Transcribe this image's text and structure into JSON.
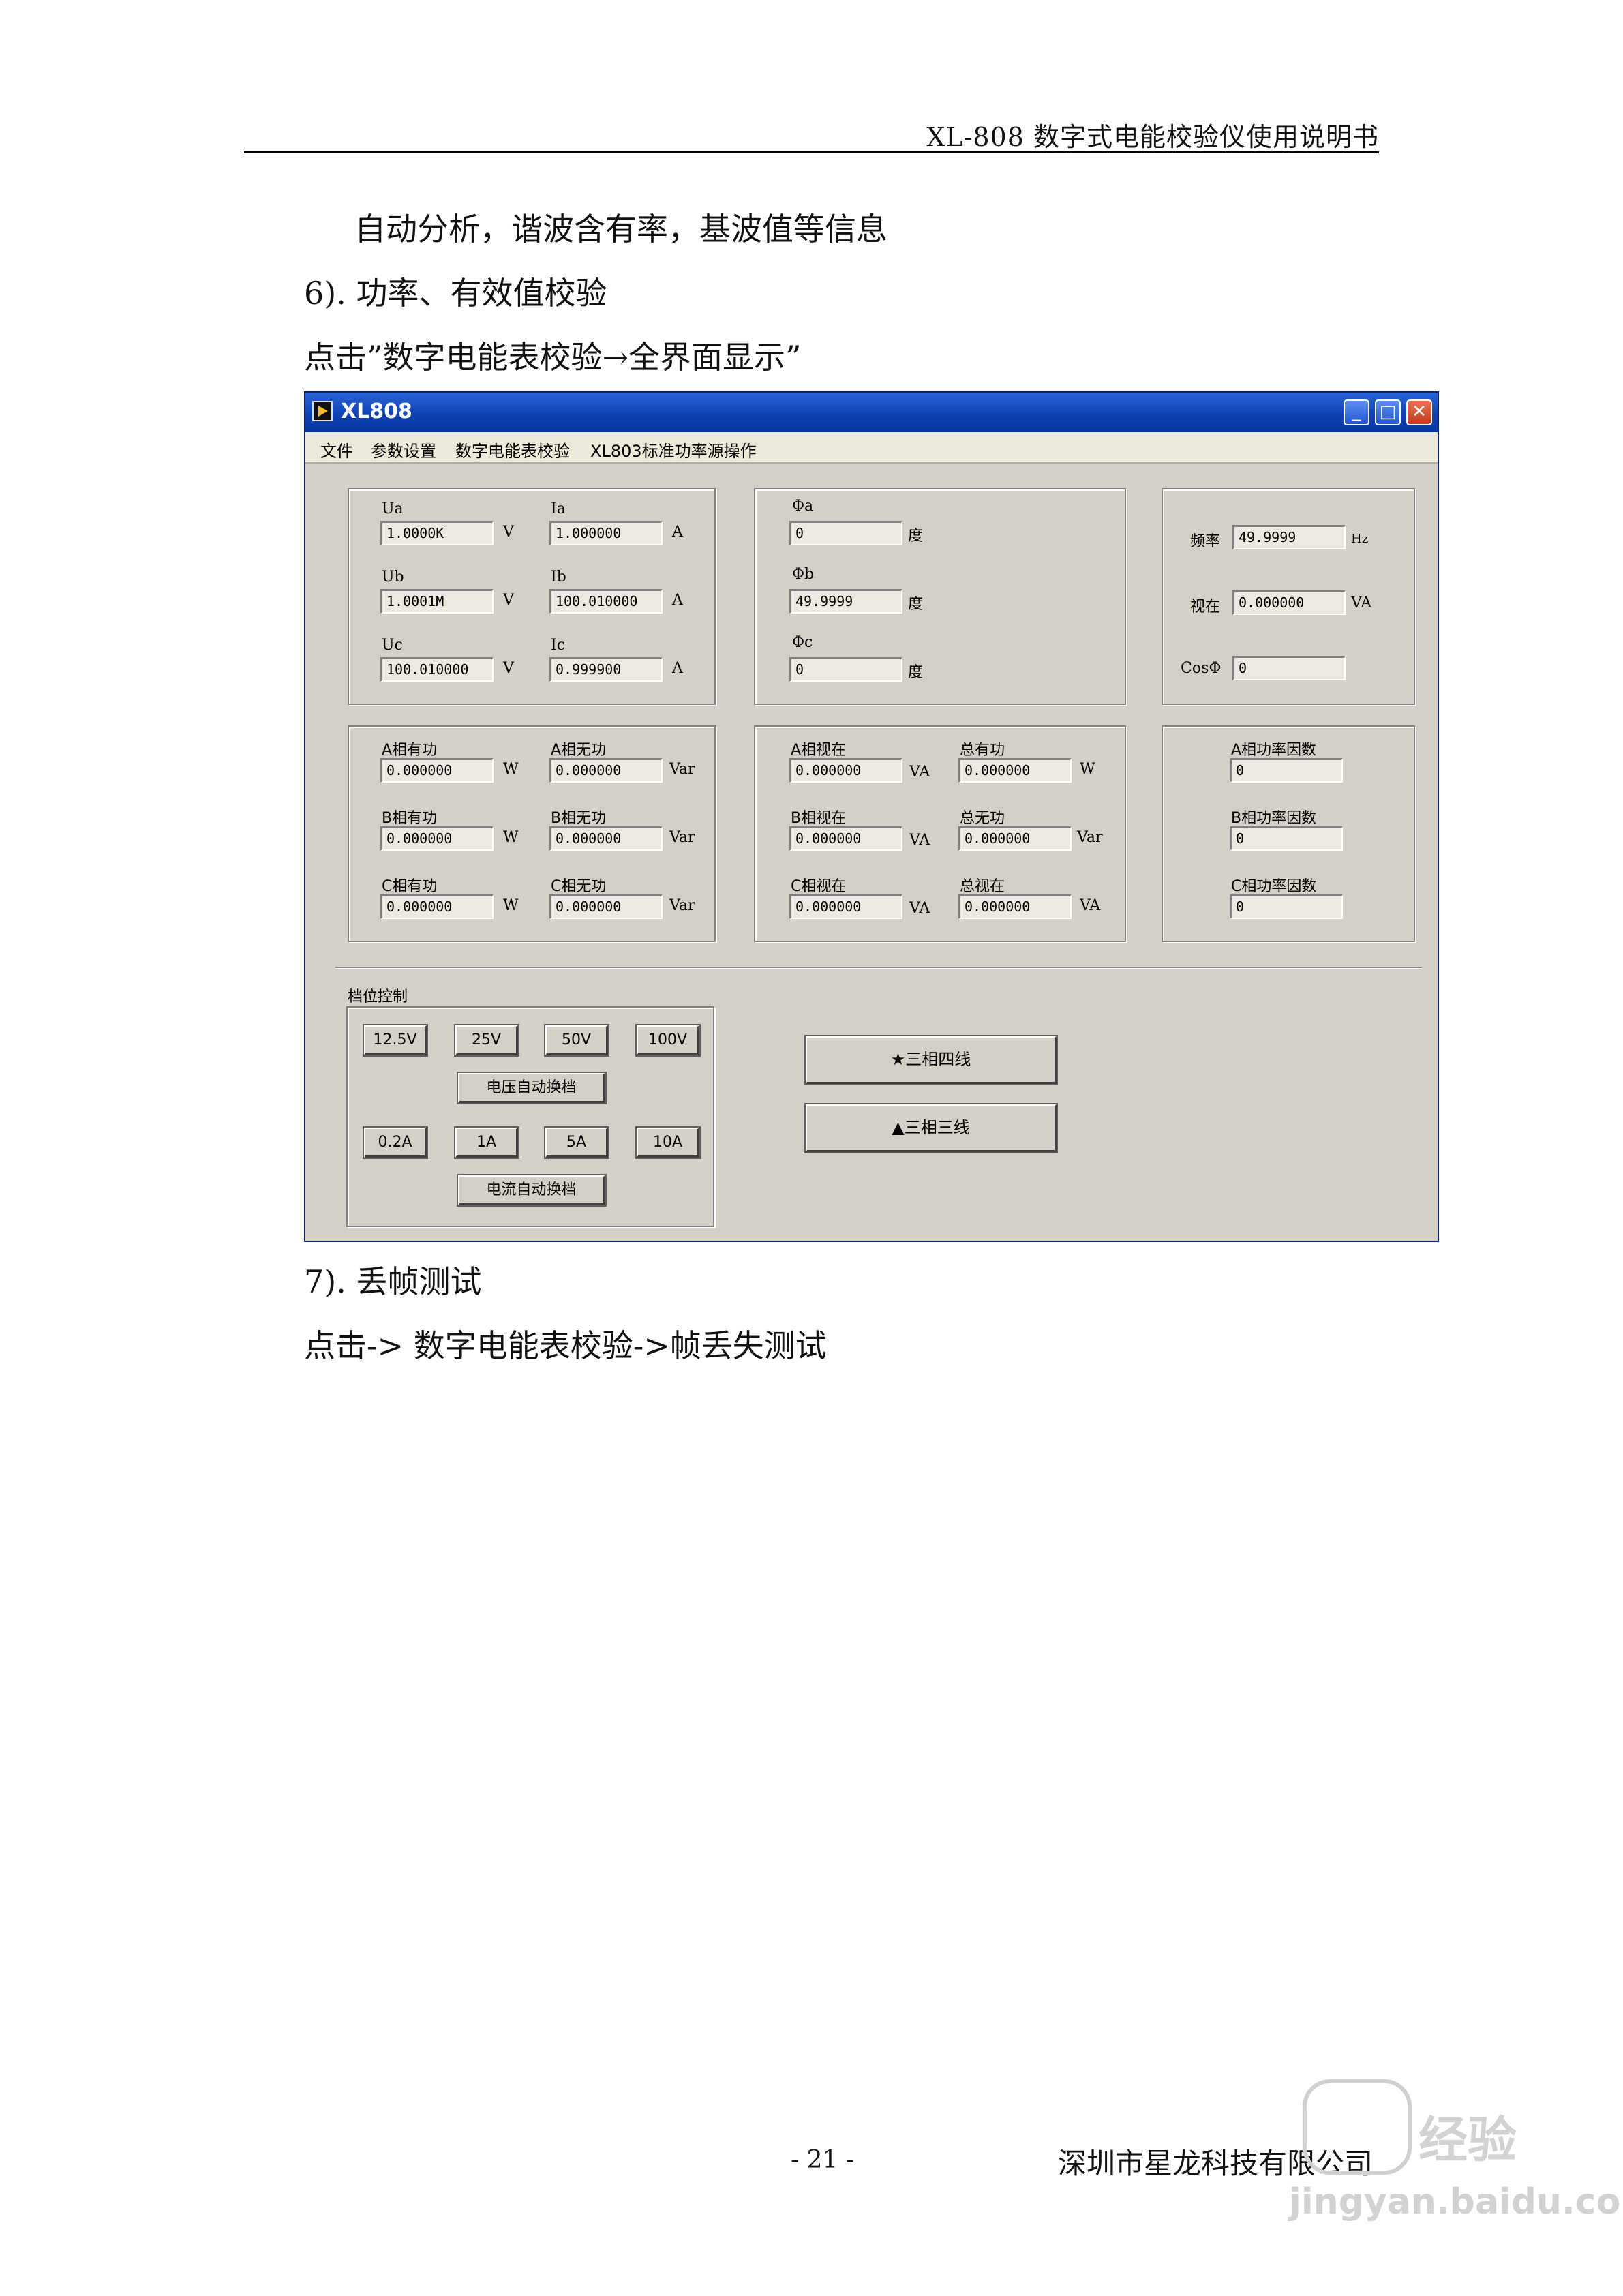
{
  "header": {
    "title": "XL-808 数字式电能校验仪使用说明书"
  },
  "body": {
    "p1": "自动分析，谐波含有率，基波值等信息",
    "p2": "6). 功率、有效值校验",
    "p3": "点击”数字电能表校验→全界面显示”",
    "p4": "7). 丢帧测试",
    "p5": "点击-> 数字电能表校验->帧丢失测试"
  },
  "window": {
    "title": "XL808",
    "controls": {
      "minimize": "_",
      "maximize": "□",
      "close": "✕"
    },
    "menu": [
      "文件",
      "参数设置",
      "数字电能表校验",
      "XL803标准功率源操作"
    ],
    "voltage": {
      "ua_label": "Ua",
      "ua_value": "1.0000K",
      "ua_unit": "V",
      "ub_label": "Ub",
      "ub_value": "1.0001M",
      "ub_unit": "V",
      "uc_label": "Uc",
      "uc_value": "100.010000",
      "uc_unit": "V",
      "ia_label": "Ia",
      "ia_value": "1.000000",
      "ia_unit": "A",
      "ib_label": "Ib",
      "ib_value": "100.010000",
      "ib_unit": "A",
      "ic_label": "Ic",
      "ic_value": "0.999900",
      "ic_unit": "A"
    },
    "phase": {
      "a_label": "Φa",
      "a_value": "0",
      "a_unit": "度",
      "b_label": "Φb",
      "b_value": "49.9999",
      "b_unit": "度",
      "c_label": "Φc",
      "c_value": "0",
      "c_unit": "度"
    },
    "freq": {
      "freq_label": "频率",
      "freq_value": "49.9999",
      "freq_unit": "Hz",
      "apparent_label": "视在",
      "apparent_value": "0.000000",
      "apparent_unit": "VA",
      "cos_label": "CosΦ",
      "cos_value": "0"
    },
    "power": {
      "a_active_label": "A相有功",
      "a_active_value": "0.000000",
      "a_active_unit": "W",
      "b_active_label": "B相有功",
      "b_active_value": "0.000000",
      "b_active_unit": "W",
      "c_active_label": "C相有功",
      "c_active_value": "0.000000",
      "c_active_unit": "W",
      "a_reactive_label": "A相无功",
      "a_reactive_value": "0.000000",
      "a_reactive_unit": "Var",
      "b_reactive_label": "B相无功",
      "b_reactive_value": "0.000000",
      "b_reactive_unit": "Var",
      "c_reactive_label": "C相无功",
      "c_reactive_value": "0.000000",
      "c_reactive_unit": "Var"
    },
    "apparent": {
      "a_label": "A相视在",
      "a_value": "0.000000",
      "a_unit": "VA",
      "b_label": "B相视在",
      "b_value": "0.000000",
      "b_unit": "VA",
      "c_label": "C相视在",
      "c_value": "0.000000",
      "c_unit": "VA",
      "total_active_label": "总有功",
      "total_active_value": "0.000000",
      "total_active_unit": "W",
      "total_reactive_label": "总无功",
      "total_reactive_value": "0.000000",
      "total_reactive_unit": "Var",
      "total_apparent_label": "总视在",
      "total_apparent_value": "0.000000",
      "total_apparent_unit": "VA"
    },
    "pf": {
      "a_label": "A相功率因数",
      "a_value": "0",
      "b_label": "B相功率因数",
      "b_value": "0",
      "c_label": "C相功率因数",
      "c_value": "0"
    },
    "range": {
      "title": "档位控制",
      "v_buttons": [
        "12.5V",
        "25V",
        "50V",
        "100V"
      ],
      "v_auto": "电压自动换档",
      "a_buttons": [
        "0.2A",
        "1A",
        "5A",
        "10A"
      ],
      "a_auto": "电流自动换档"
    },
    "mode": {
      "four_wire": "★三相四线",
      "three_wire": "▲三相三线"
    }
  },
  "footer": {
    "page": "- 21 -",
    "company": "深圳市星龙科技有限公司"
  },
  "watermark": {
    "brand": "经验",
    "url": "jingyan.baidu.com"
  }
}
